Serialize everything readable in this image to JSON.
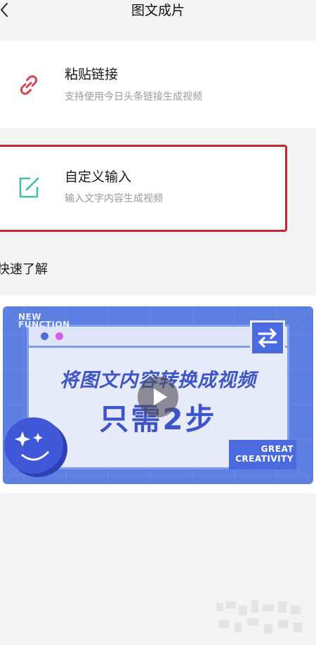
{
  "header": {
    "title": "图文成片",
    "back_icon": "chevron-left-icon"
  },
  "options": [
    {
      "title": "粘贴链接",
      "subtitle": "支持使用今日头条链接生成视频",
      "icon": "link-icon",
      "icon_color": "#d8454e"
    },
    {
      "title": "自定义输入",
      "subtitle": "输入文字内容生成视频",
      "icon": "edit-icon",
      "icon_color": "#3fc1a4",
      "highlighted": true,
      "highlight_color": "#c9252d"
    }
  ],
  "quick_learn": {
    "title": "快速了解",
    "video": {
      "tag_line1": "NEW",
      "tag_line2": "FUNCTION",
      "headline": "将图文内容转换成视频",
      "headline2": "只需2步",
      "corner_line1": "GREAT",
      "corner_line2": "CREATIVITY",
      "accent_color": "#5e7fe2"
    }
  }
}
